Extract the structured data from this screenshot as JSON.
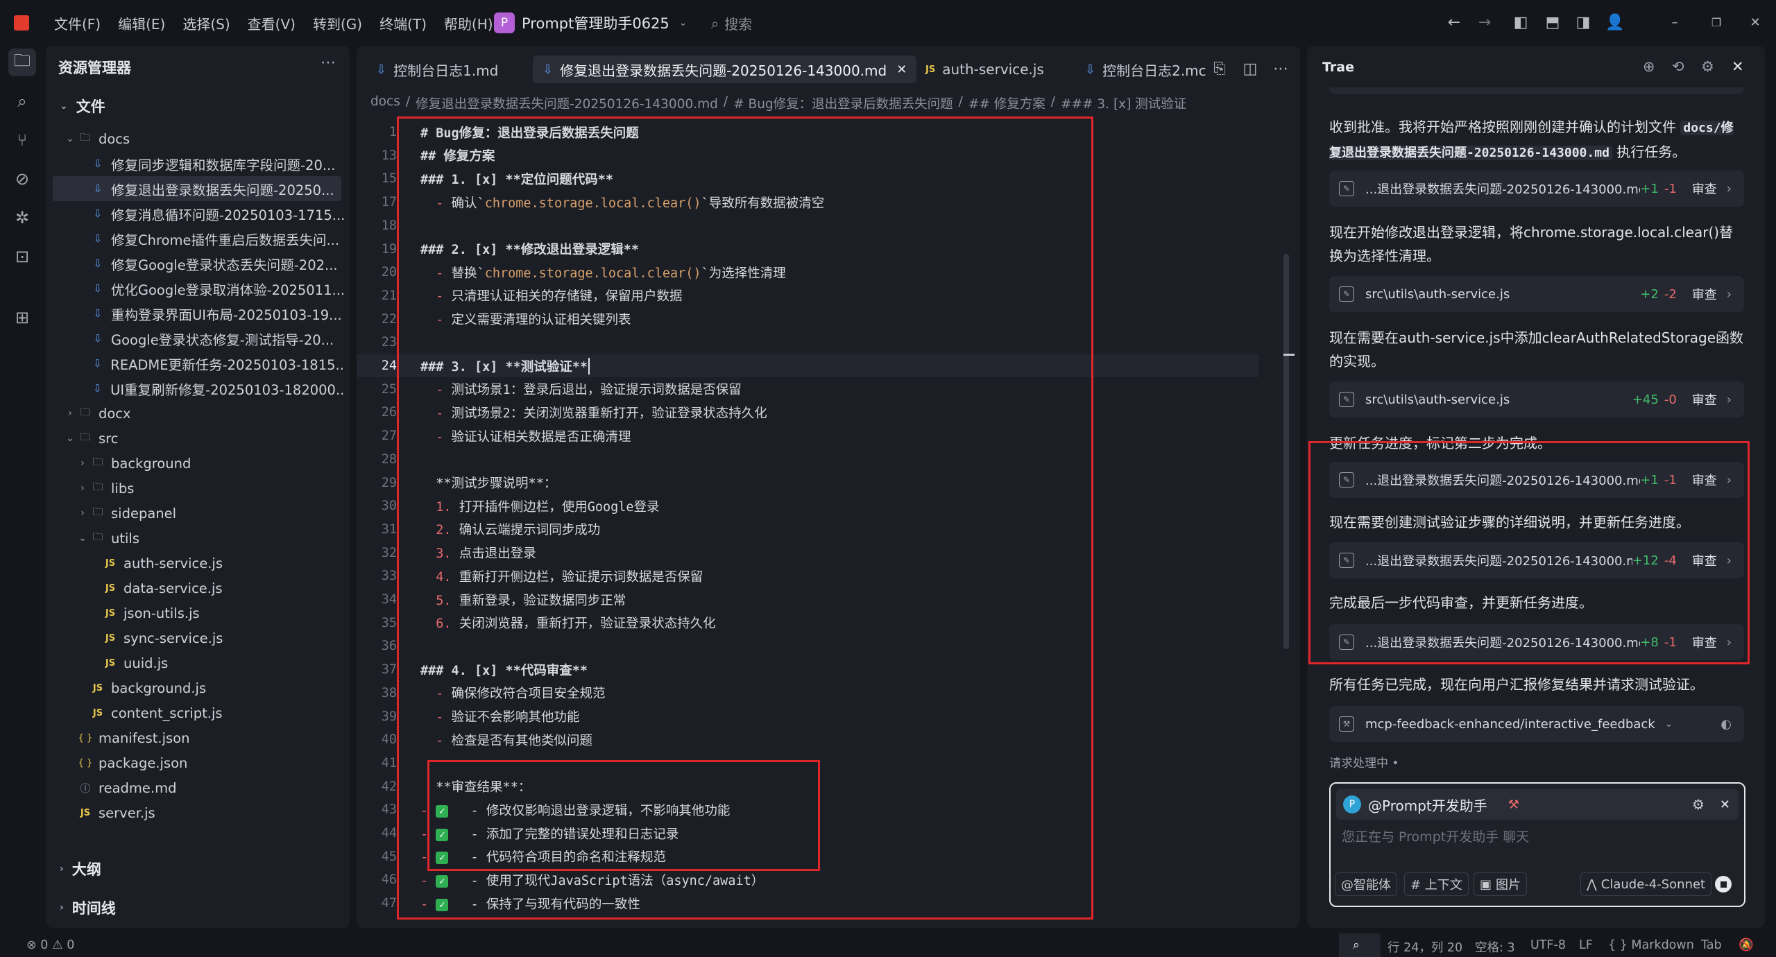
{
  "menu": [
    "文件(F)",
    "编辑(E)",
    "选择(S)",
    "查看(V)",
    "转到(G)",
    "终端(T)",
    "帮助(H)"
  ],
  "project": {
    "badge": "P",
    "name": "Prompt管理助手0625"
  },
  "search_label": "搜索",
  "explorer": {
    "title": "资源管理器",
    "section_files": "文件",
    "section_outline": "大纲",
    "section_timeline": "时间线",
    "tree": [
      {
        "depth": 0,
        "type": "folder",
        "open": true,
        "name": "docs"
      },
      {
        "depth": 1,
        "type": "md",
        "name": "修复同步逻辑和数据库字段问题-20..."
      },
      {
        "depth": 1,
        "type": "md",
        "name": "修复退出登录数据丢失问题-20250...",
        "selected": true
      },
      {
        "depth": 1,
        "type": "md",
        "name": "修复消息循环问题-20250103-1715..."
      },
      {
        "depth": 1,
        "type": "md",
        "name": "修复Chrome插件重启后数据丢失问..."
      },
      {
        "depth": 1,
        "type": "md",
        "name": "修复Google登录状态丢失问题-202..."
      },
      {
        "depth": 1,
        "type": "md",
        "name": "优化Google登录取消体验-2025011..."
      },
      {
        "depth": 1,
        "type": "md",
        "name": "重构登录界面UI布局-20250103-19..."
      },
      {
        "depth": 1,
        "type": "md",
        "name": "Google登录状态修复-测试指导-20..."
      },
      {
        "depth": 1,
        "type": "md",
        "name": "README更新任务-20250103-1815..."
      },
      {
        "depth": 1,
        "type": "md",
        "name": "UI重复刷新修复-20250103-182000..."
      },
      {
        "depth": 0,
        "type": "folder",
        "open": false,
        "name": "docx"
      },
      {
        "depth": 0,
        "type": "folder",
        "open": true,
        "name": "src"
      },
      {
        "depth": 1,
        "type": "folder",
        "open": false,
        "name": "background"
      },
      {
        "depth": 1,
        "type": "folder",
        "open": false,
        "name": "libs"
      },
      {
        "depth": 1,
        "type": "folder",
        "open": false,
        "name": "sidepanel"
      },
      {
        "depth": 1,
        "type": "folder",
        "open": true,
        "name": "utils"
      },
      {
        "depth": 2,
        "type": "js",
        "name": "auth-service.js"
      },
      {
        "depth": 2,
        "type": "js",
        "name": "data-service.js"
      },
      {
        "depth": 2,
        "type": "js",
        "name": "json-utils.js"
      },
      {
        "depth": 2,
        "type": "js",
        "name": "sync-service.js"
      },
      {
        "depth": 2,
        "type": "js",
        "name": "uuid.js"
      },
      {
        "depth": 1,
        "type": "js",
        "name": "background.js"
      },
      {
        "depth": 1,
        "type": "js",
        "name": "content_script.js"
      },
      {
        "depth": 0,
        "type": "json",
        "name": "manifest.json"
      },
      {
        "depth": 0,
        "type": "json",
        "name": "package.json"
      },
      {
        "depth": 0,
        "type": "readme",
        "name": "readme.md"
      },
      {
        "depth": 0,
        "type": "js",
        "name": "server.js"
      }
    ]
  },
  "tabs": [
    {
      "icon": "md",
      "label": "控制台日志1.md"
    },
    {
      "icon": "md",
      "label": "修复退出登录数据丢失问题-20250126-143000.md",
      "active": true
    },
    {
      "icon": "js",
      "label": "auth-service.js"
    },
    {
      "icon": "md",
      "label": "控制台日志2.mc"
    }
  ],
  "breadcrumb": [
    "docs",
    "/",
    "修复退出登录数据丢失问题-20250126-143000.md",
    "/",
    "# Bug修复：退出登录后数据丢失问题",
    "/",
    "## 修复方案",
    "/",
    "### 3. [x] 测试验证"
  ],
  "code": [
    {
      "n": "1",
      "t": "# Bug修复：退出登录后数据丢失问题",
      "k": "h"
    },
    {
      "n": "13",
      "t": "## 修复方案",
      "k": "h"
    },
    {
      "n": "15",
      "t": "### 1. [x] **定位问题代码**",
      "k": "h3"
    },
    {
      "n": "17",
      "t": "  - 确认`chrome.storage.local.clear()`导致所有数据被清空",
      "k": "li"
    },
    {
      "n": "18",
      "t": "",
      "k": ""
    },
    {
      "n": "19",
      "t": "### 2. [x] **修改退出登录逻辑**",
      "k": "h3"
    },
    {
      "n": "20",
      "t": "  - 替换`chrome.storage.local.clear()`为选择性清理",
      "k": "li"
    },
    {
      "n": "21",
      "t": "  - 只清理认证相关的存储键，保留用户数据",
      "k": "li"
    },
    {
      "n": "22",
      "t": "  - 定义需要清理的认证相关键列表",
      "k": "li"
    },
    {
      "n": "23",
      "t": "",
      "k": ""
    },
    {
      "n": "24",
      "t": "### 3. [x] **测试验证**",
      "k": "h3",
      "cur": true
    },
    {
      "n": "25",
      "t": "  - 测试场景1：登录后退出，验证提示词数据是否保留",
      "k": "li"
    },
    {
      "n": "26",
      "t": "  - 测试场景2：关闭浏览器重新打开，验证登录状态持久化",
      "k": "li"
    },
    {
      "n": "27",
      "t": "  - 验证认证相关数据是否正确清理",
      "k": "li"
    },
    {
      "n": "28",
      "t": "",
      "k": ""
    },
    {
      "n": "29",
      "t": "  **测试步骤说明**：",
      "k": "p"
    },
    {
      "n": "30",
      "t": "  1. 打开插件侧边栏，使用Google登录",
      "k": "ol"
    },
    {
      "n": "31",
      "t": "  2. 确认云端提示词同步成功",
      "k": "ol"
    },
    {
      "n": "32",
      "t": "  3. 点击退出登录",
      "k": "ol"
    },
    {
      "n": "33",
      "t": "  4. 重新打开侧边栏，验证提示词数据是否保留",
      "k": "ol"
    },
    {
      "n": "34",
      "t": "  5. 重新登录，验证数据同步正常",
      "k": "ol"
    },
    {
      "n": "35",
      "t": "  6. 关闭浏览器，重新打开，验证登录状态持久化",
      "k": "ol"
    },
    {
      "n": "36",
      "t": "",
      "k": ""
    },
    {
      "n": "37",
      "t": "### 4. [x] **代码审查**",
      "k": "h3"
    },
    {
      "n": "38",
      "t": "  - 确保修改符合项目安全规范",
      "k": "li"
    },
    {
      "n": "39",
      "t": "  - 验证不会影响其他功能",
      "k": "li"
    },
    {
      "n": "40",
      "t": "  - 检查是否有其他类似问题",
      "k": "li"
    },
    {
      "n": "41",
      "t": "",
      "k": ""
    },
    {
      "n": "42",
      "t": "  **审查结果**：",
      "k": "p"
    },
    {
      "n": "43",
      "t": "  - 修改仅影响退出登录逻辑，不影响其他功能",
      "k": "chk"
    },
    {
      "n": "44",
      "t": "  - 添加了完整的错误处理和日志记录",
      "k": "chk"
    },
    {
      "n": "45",
      "t": "  - 代码符合项目的命名和注释规范",
      "k": "chk"
    },
    {
      "n": "46",
      "t": "  - 使用了现代JavaScript语法（async/await）",
      "k": "chk"
    },
    {
      "n": "47",
      "t": "  - 保持了与现有代码的一致性",
      "k": "chk"
    }
  ],
  "trae": {
    "title": "Trae",
    "msg1_a": "收到批准。我将开始严格按照刚刚创建并确认的计划文件 ",
    "msg1_code1": "docs/修复退出登录数据丢失问题-20250126-143000.md",
    "msg1_b": " 执行任务。",
    "cards": [
      {
        "path": "...退出登录数据丢失问题-20250126-143000.md",
        "plus": "+1",
        "minus": "-1"
      },
      {
        "path": "src\\utils\\auth-service.js",
        "plus": "+2",
        "minus": "-2"
      },
      {
        "path": "src\\utils\\auth-service.js",
        "plus": "+45",
        "minus": "-0"
      },
      {
        "path": "...退出登录数据丢失问题-20250126-143000.md",
        "plus": "+1",
        "minus": "-1"
      },
      {
        "path": "...退出登录数据丢失问题-20250126-143000.md",
        "plus": "+12",
        "minus": "-4"
      },
      {
        "path": "...退出登录数据丢失问题-20250126-143000.md",
        "plus": "+8",
        "minus": "-1"
      }
    ],
    "review_label": "审查",
    "msg2": "现在开始修改退出登录逻辑，将chrome.storage.local.clear()替换为选择性清理。",
    "msg3": "现在需要在auth-service.js中添加clearAuthRelatedStorage函数的实现。",
    "msg4": "更新任务进度，标记第二步为完成。",
    "msg5": "现在需要创建测试验证步骤的详细说明，并更新任务进度。",
    "msg6": "完成最后一步代码审查，并更新任务进度。",
    "msg7": "所有任务已完成，现在向用户汇报修复结果并请求测试验证。",
    "tool_card": "mcp-feedback-enhanced/interactive_feedback",
    "processing": "请求处理中 •",
    "chat": {
      "agent_badge": "P",
      "agent": "@Prompt开发助手",
      "placeholder": "您正在与 Prompt开发助手 聊天",
      "chips": [
        "@智能体",
        "# 上下文",
        "图片"
      ],
      "model": "Claude-4-Sonnet"
    }
  },
  "status": {
    "errors": "0",
    "warnings": "0",
    "cursor": "行 24，列 20",
    "spaces": "空格: 3",
    "encoding": "UTF-8",
    "eol": "LF",
    "language": "Markdown",
    "tab": "Tab"
  }
}
